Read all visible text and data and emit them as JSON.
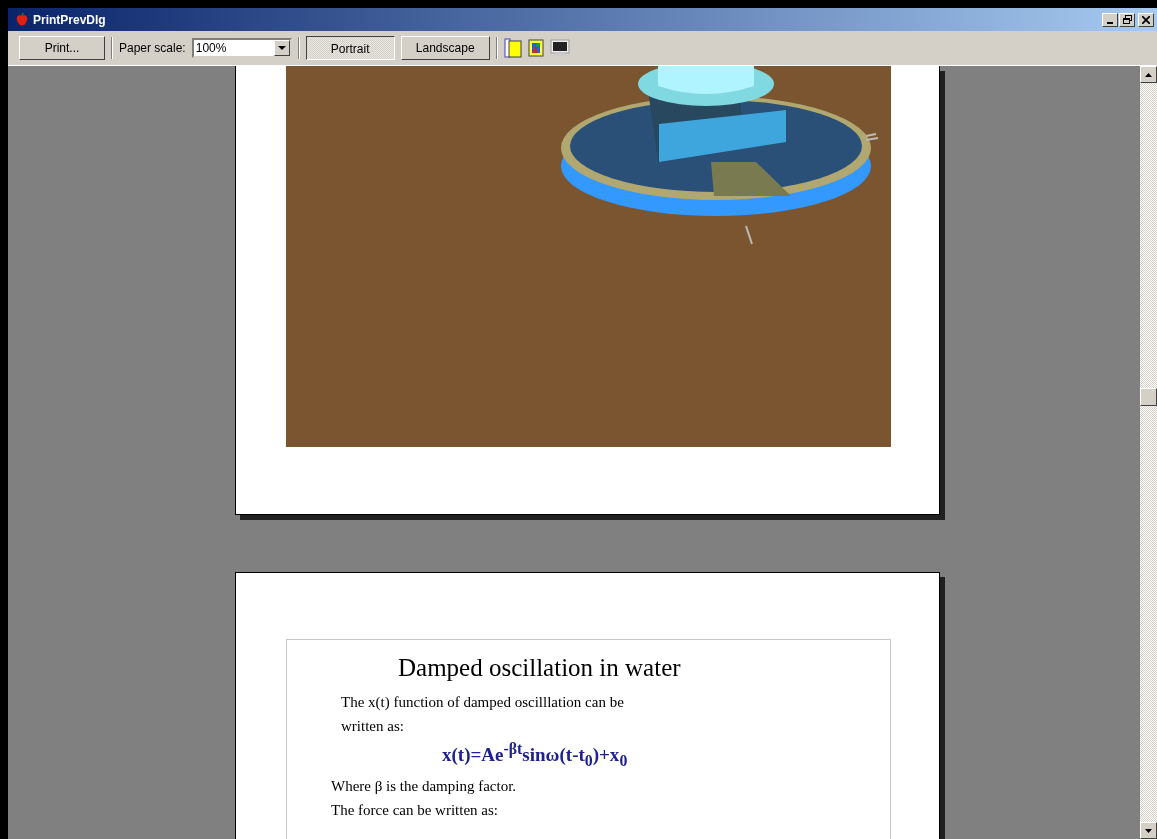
{
  "window": {
    "title": "PrintPrevDlg"
  },
  "toolbar": {
    "print_button": "Print...",
    "scale_label": "Paper scale:",
    "scale_value": "100%",
    "orientation": [
      {
        "label": "Portrait",
        "selected": true
      },
      {
        "label": "Landscape",
        "selected": false
      }
    ]
  },
  "document": {
    "title": "Damped oscillation in water",
    "paragraphs": [
      {
        "kind": "text",
        "text": "The x(t) function of  damped oscilllation  can be written as:"
      },
      {
        "kind": "formula",
        "text": "x(t)=Ae$^{-βt}$sinω(t-t$_{0}$)+x$_{0}$"
      },
      {
        "kind": "text",
        "text": "Where β is the damping factor."
      },
      {
        "kind": "text",
        "text": "The force can be written as:"
      }
    ]
  }
}
